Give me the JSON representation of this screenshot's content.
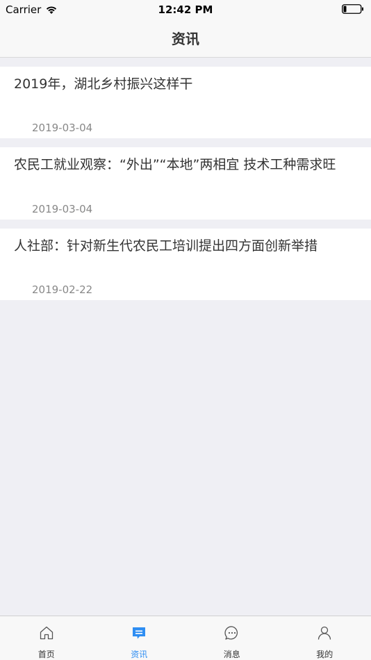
{
  "status_bar": {
    "carrier": "Carrier",
    "time": "12:42 PM"
  },
  "nav": {
    "title": "资讯"
  },
  "news": [
    {
      "title": "2019年，湖北乡村振兴这样干",
      "date": "2019-03-04"
    },
    {
      "title": "农民工就业观察：“外出”“本地”两相宜 技术工种需求旺",
      "date": "2019-03-04"
    },
    {
      "title": "人社部：针对新生代农民工培训提出四方面创新举措",
      "date": "2019-02-22"
    }
  ],
  "tabbar": {
    "items": [
      {
        "label": "首页",
        "icon": "home-icon",
        "active": false
      },
      {
        "label": "资讯",
        "icon": "news-icon",
        "active": true
      },
      {
        "label": "消息",
        "icon": "message-icon",
        "active": false
      },
      {
        "label": "我的",
        "icon": "profile-icon",
        "active": false
      }
    ]
  },
  "colors": {
    "accent": "#2f8ef2",
    "background": "#efeff4",
    "text": "#333333",
    "secondary_text": "#888888"
  }
}
